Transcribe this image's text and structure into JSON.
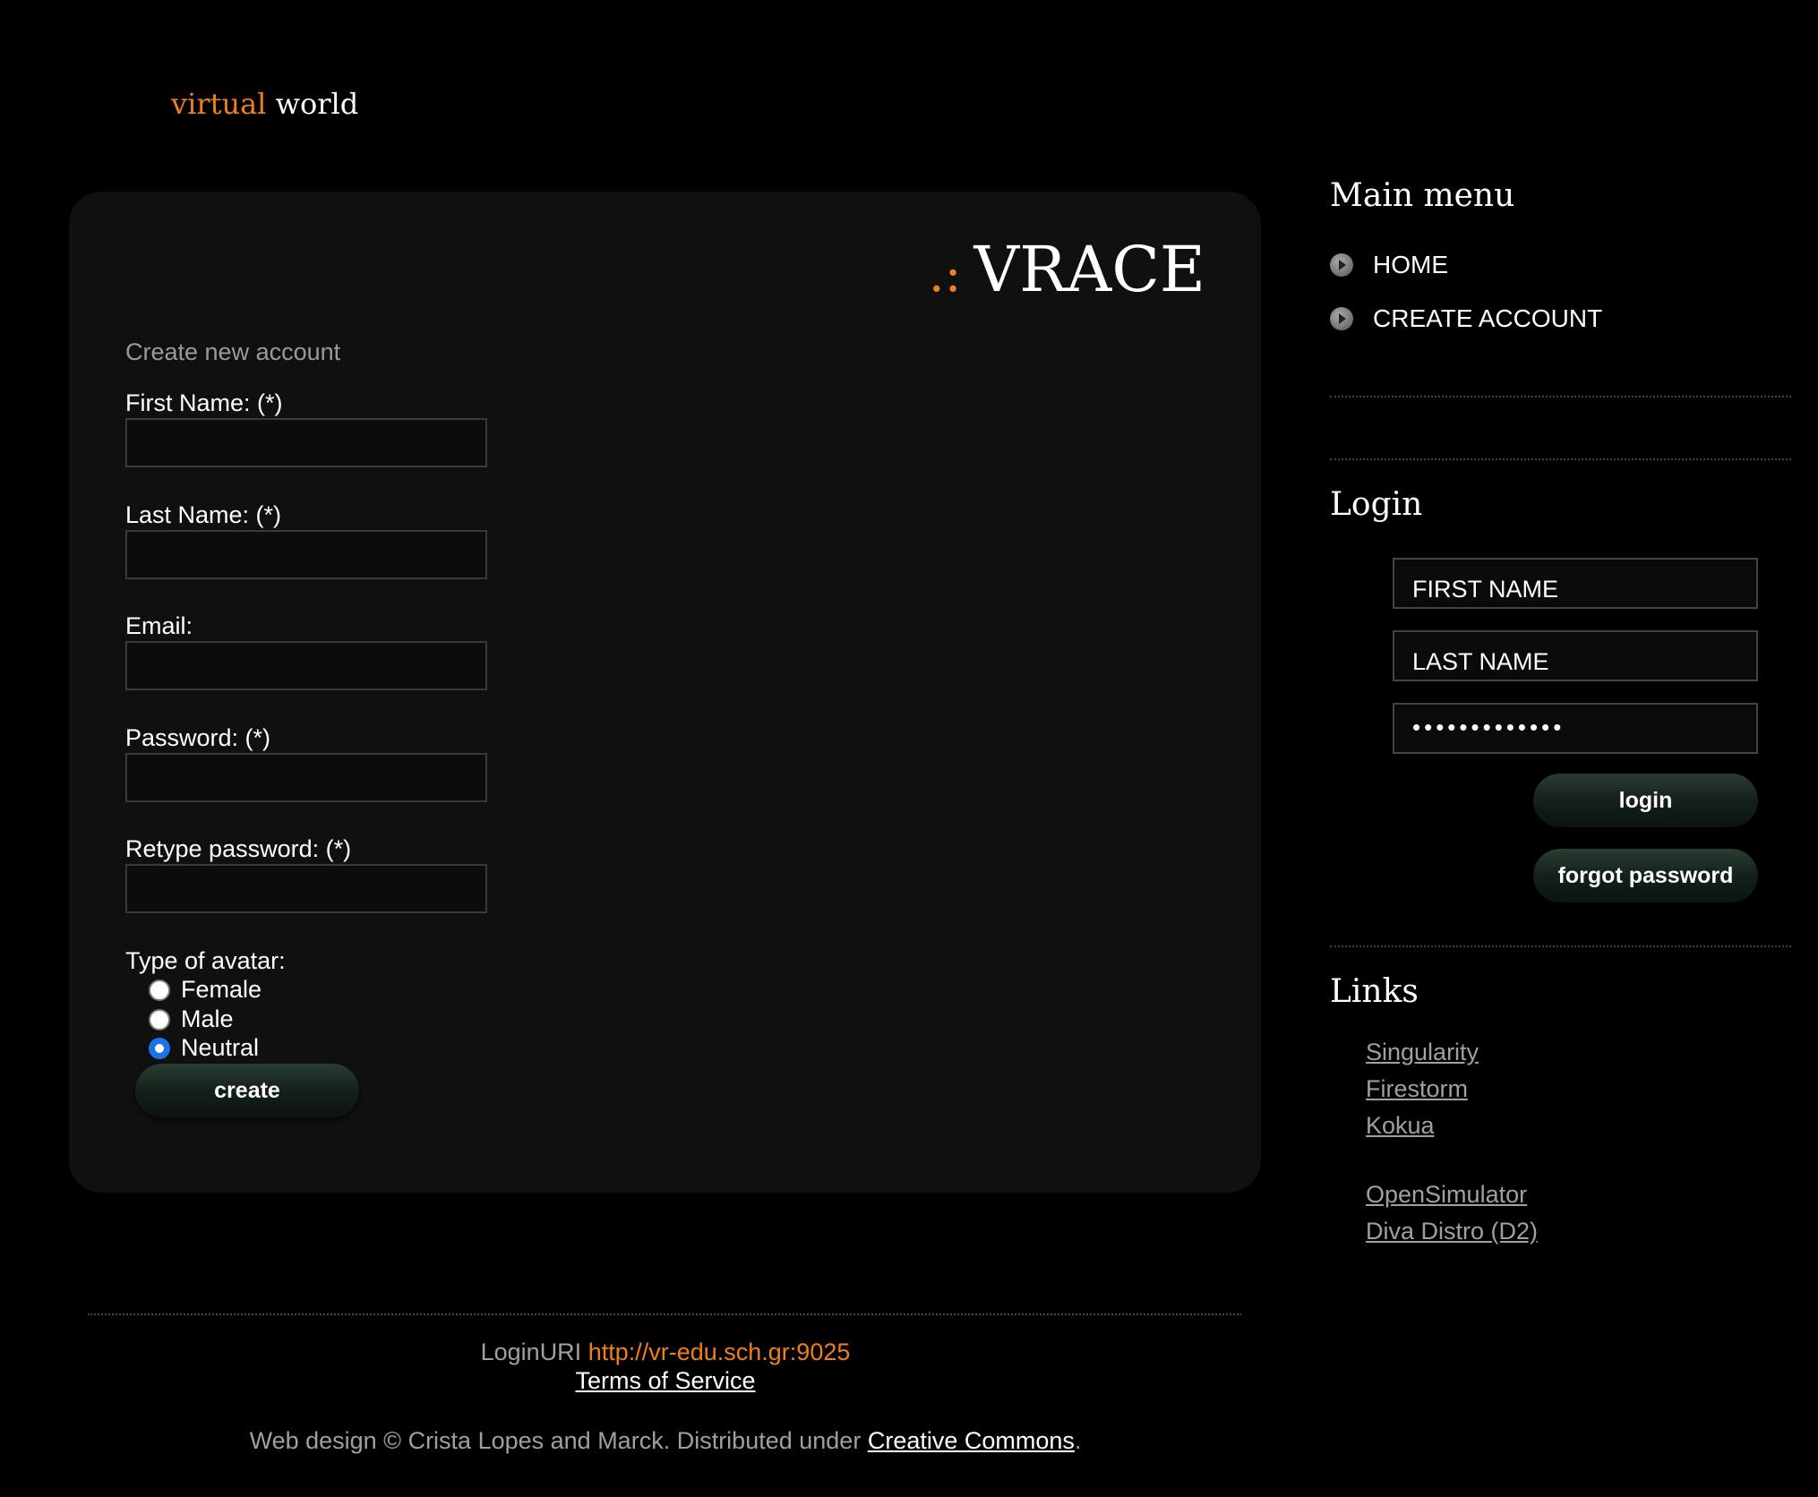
{
  "brand": {
    "word1": "virtual",
    "word2": "world"
  },
  "panel": {
    "logo_dots": ".:",
    "logo_text": "VRACE",
    "heading": "Create new account",
    "fields": [
      {
        "label": "First Name: (*)",
        "value": ""
      },
      {
        "label": "Last Name: (*)",
        "value": ""
      },
      {
        "label": "Email:",
        "value": ""
      },
      {
        "label": "Password: (*)",
        "value": ""
      },
      {
        "label": "Retype password: (*)",
        "value": ""
      }
    ],
    "avatar_label": "Type of avatar:",
    "avatar_options": [
      "Female",
      "Male",
      "Neutral"
    ],
    "avatar_selected": "Neutral",
    "create_label": "create"
  },
  "sidebar": {
    "main_menu_title": "Main menu",
    "menu_items": [
      "HOME",
      "CREATE ACCOUNT"
    ],
    "login_title": "Login",
    "login_first_placeholder": "FIRST NAME",
    "login_last_placeholder": "LAST NAME",
    "login_password_mask": "•••••••••••••",
    "login_button": "login",
    "forgot_button": "forgot password",
    "links_title": "Links",
    "links": [
      "Singularity",
      "Firestorm",
      "Kokua",
      "OpenSimulator",
      "Diva Distro (D2)"
    ]
  },
  "footer": {
    "login_uri_label": "LoginURI",
    "login_uri": "http://vr-edu.sch.gr:9025",
    "terms": "Terms of Service",
    "credit_prefix": "Web design © Crista Lopes and Marck. Distributed under",
    "credit_link": "Creative Commons",
    "credit_suffix": "."
  },
  "colors": {
    "accent": "#f07f1a",
    "panel_bg": "#101010",
    "page_bg": "#000000"
  }
}
